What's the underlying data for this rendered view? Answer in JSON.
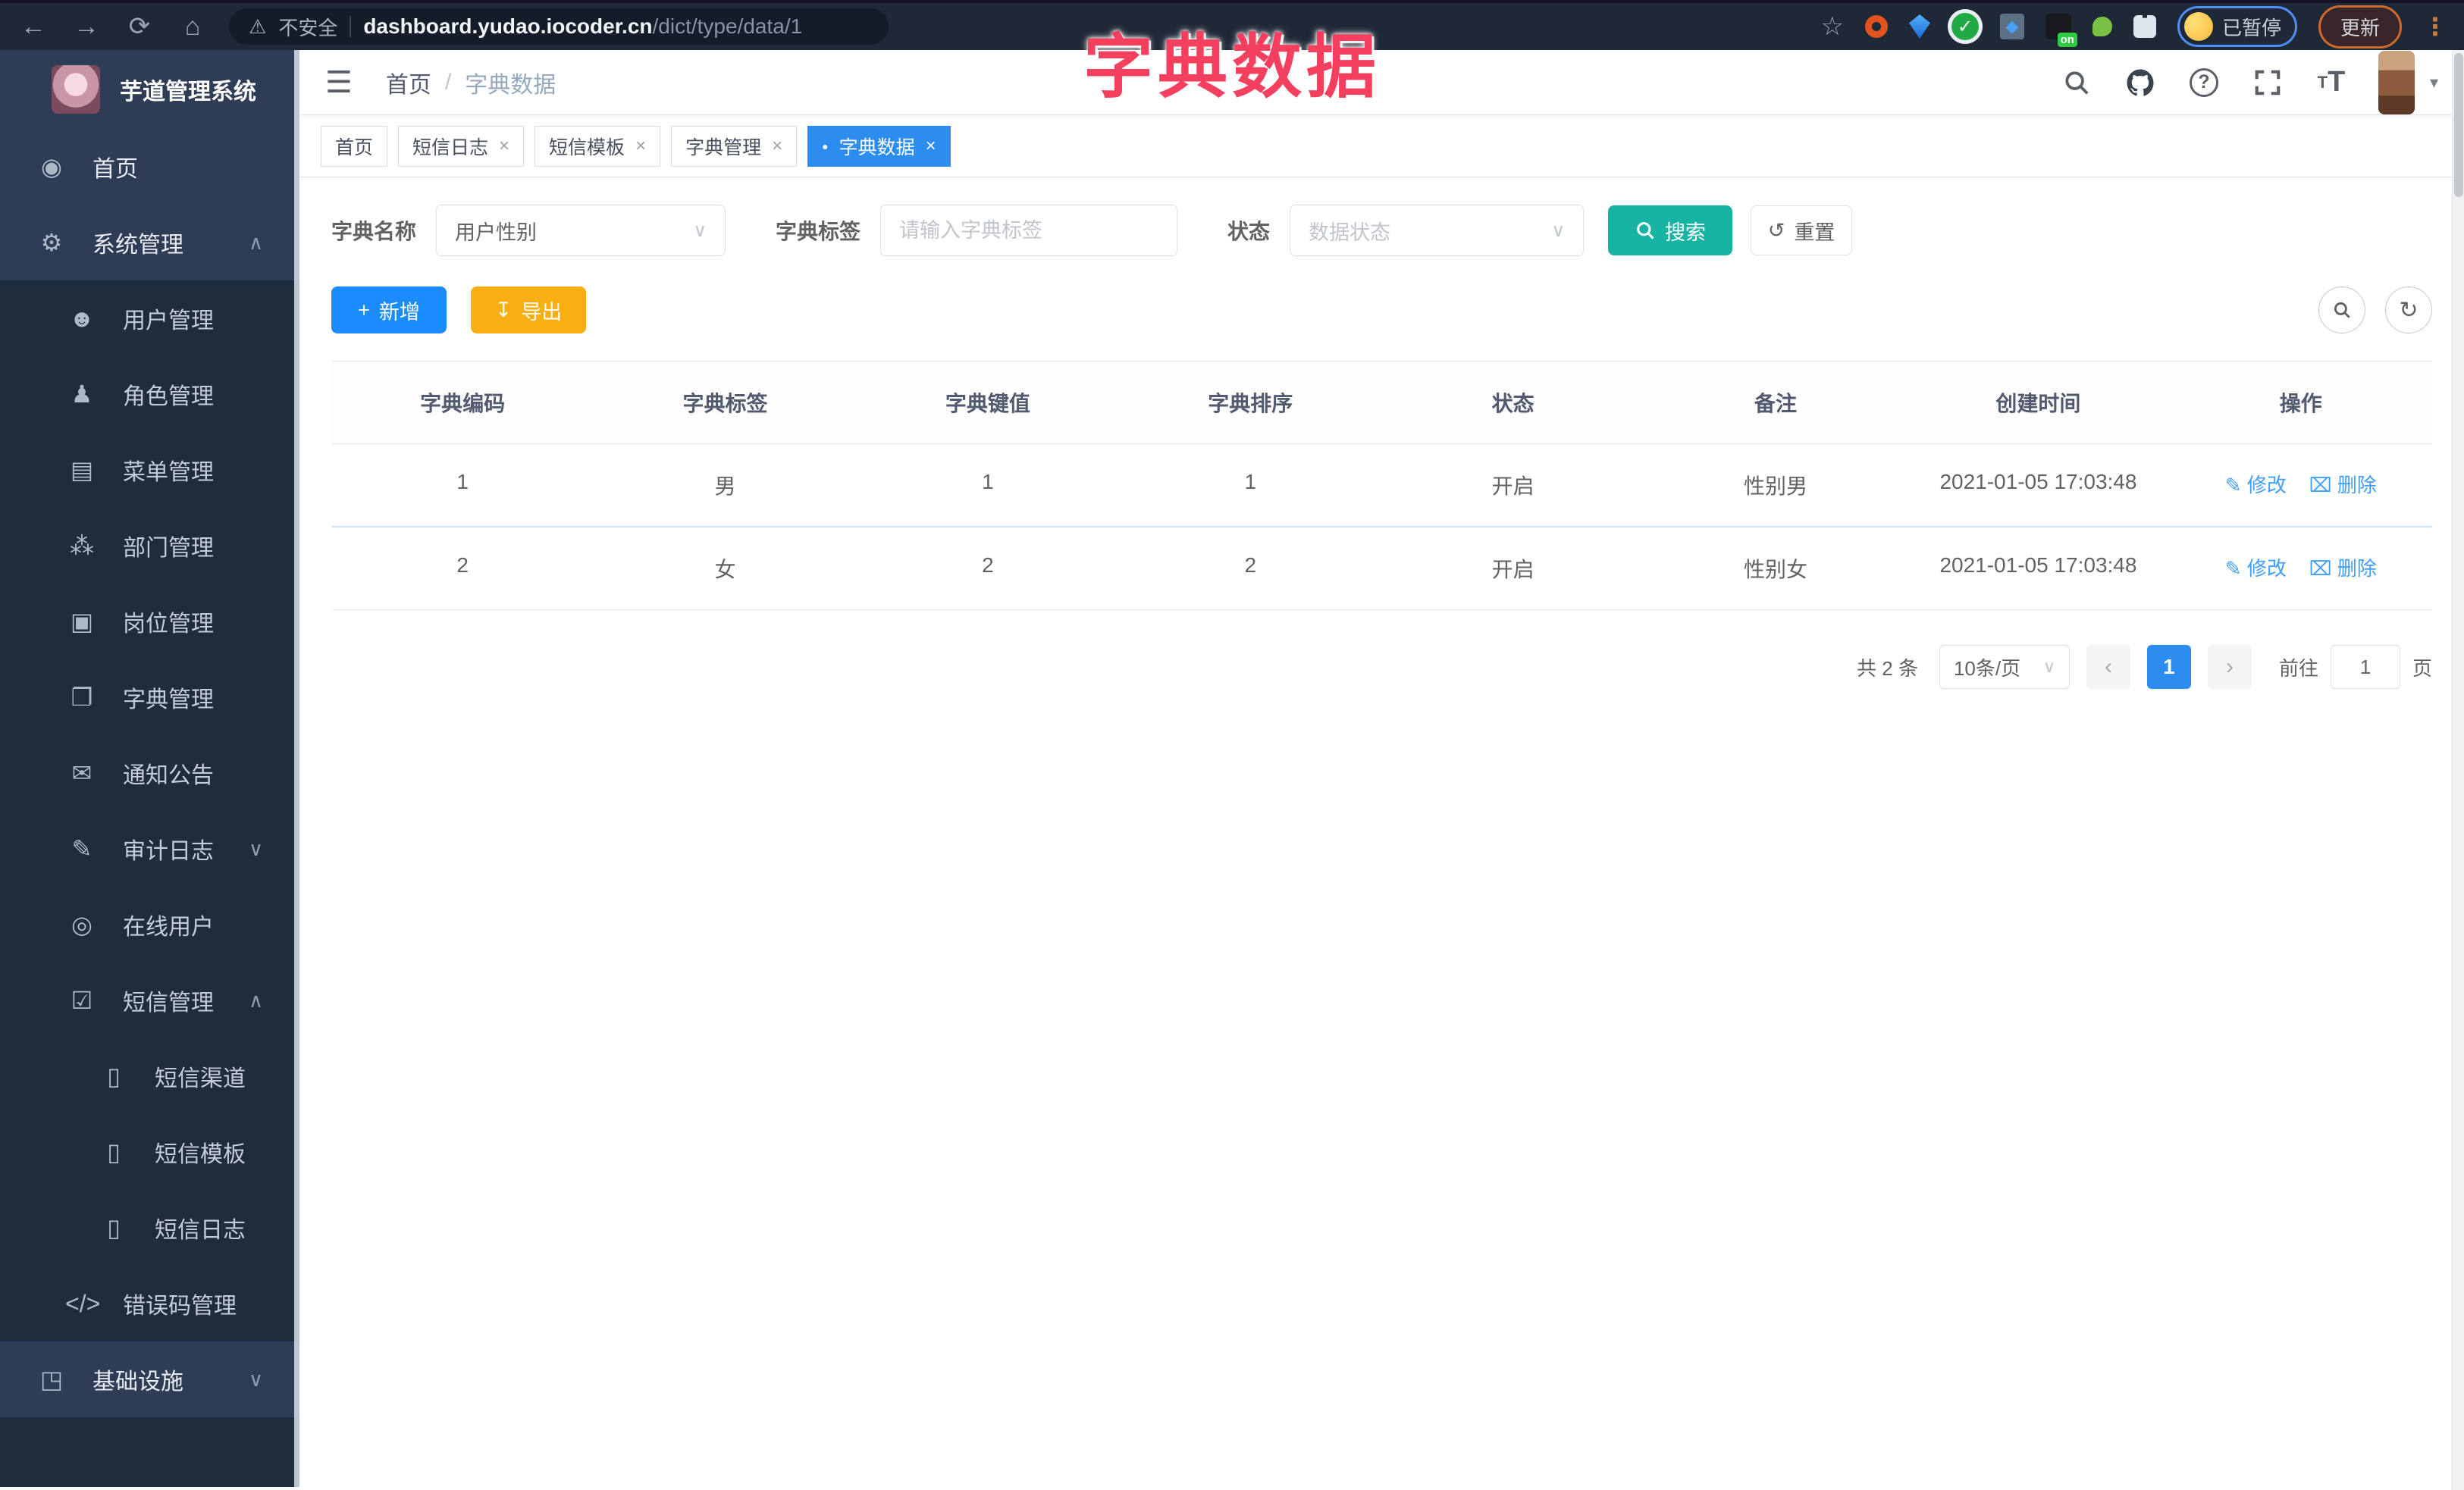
{
  "browser": {
    "security_label": "不安全",
    "url_domain": "dashboard.yudao.iocoder.cn",
    "url_path": "/dict/type/data/1",
    "extension_on_badge": "on",
    "paused_label": "已暂停",
    "update_label": "更新"
  },
  "overlay_title": "字典数据",
  "glyphs": {
    "back": "←",
    "forward": "→",
    "reload": "⟳",
    "home": "⌂",
    "warning": "⚠",
    "star": "☆",
    "kebab": "⋮",
    "hamburger": "☰",
    "caret_down": "▾",
    "check": "✓",
    "diamond": "◆",
    "select_caret": "∨",
    "collapse": "∧",
    "expand": "∨",
    "plus": "+",
    "download": "↧",
    "reset": "↺",
    "refresh": "↻",
    "edit": "✎",
    "delete": "⌧",
    "prev": "‹",
    "next": "›",
    "close": "×",
    "dot": "●",
    "help": "?",
    "font_small": "T",
    "font_big": "T"
  },
  "sidebar": {
    "logo_title": "芋道管理系统",
    "items": [
      {
        "label": "首页",
        "icon": "◉"
      },
      {
        "label": "系统管理",
        "icon": "⚙",
        "caret": "∧"
      },
      {
        "label": "用户管理",
        "icon": "☻"
      },
      {
        "label": "角色管理",
        "icon": "♟"
      },
      {
        "label": "菜单管理",
        "icon": "▤"
      },
      {
        "label": "部门管理",
        "icon": "⁂"
      },
      {
        "label": "岗位管理",
        "icon": "▣"
      },
      {
        "label": "字典管理",
        "icon": "❐"
      },
      {
        "label": "通知公告",
        "icon": "✉"
      },
      {
        "label": "审计日志",
        "icon": "✎",
        "caret": "∨"
      },
      {
        "label": "在线用户",
        "icon": "◎"
      },
      {
        "label": "短信管理",
        "icon": "☑",
        "caret": "∧"
      },
      {
        "label": "短信渠道",
        "icon": "▯"
      },
      {
        "label": "短信模板",
        "icon": "▯"
      },
      {
        "label": "短信日志",
        "icon": "▯"
      },
      {
        "label": "错误码管理",
        "icon": "</>"
      },
      {
        "label": "基础设施",
        "icon": "◳",
        "caret": "∨"
      }
    ]
  },
  "header": {
    "breadcrumb": {
      "home": "首页",
      "sep": "/",
      "current": "字典数据"
    }
  },
  "tabs": [
    {
      "label": "首页"
    },
    {
      "label": "短信日志"
    },
    {
      "label": "短信模板"
    },
    {
      "label": "字典管理"
    },
    {
      "label": "字典数据"
    }
  ],
  "filters": {
    "dict_name_label": "字典名称",
    "dict_name_value": "用户性别",
    "dict_label_label": "字典标签",
    "dict_label_placeholder": "请输入字典标签",
    "status_label": "状态",
    "status_placeholder": "数据状态",
    "search_label": "搜索",
    "reset_label": "重置"
  },
  "toolbar": {
    "add_label": "新增",
    "export_label": "导出"
  },
  "table": {
    "headers": [
      "字典编码",
      "字典标签",
      "字典键值",
      "字典排序",
      "状态",
      "备注",
      "创建时间",
      "操作"
    ],
    "actions": {
      "edit": "修改",
      "delete": "删除"
    },
    "rows": [
      {
        "code": "1",
        "label": "男",
        "value": "1",
        "sort": "1",
        "status": "开启",
        "remark": "性别男",
        "created": "2021-01-05 17:03:48"
      },
      {
        "code": "2",
        "label": "女",
        "value": "2",
        "sort": "2",
        "status": "开启",
        "remark": "性别女",
        "created": "2021-01-05 17:03:48"
      }
    ]
  },
  "pagination": {
    "total_text": "共 2 条",
    "page_size": "10条/页",
    "current_page": "1",
    "goto_label": "前往",
    "goto_value": "1",
    "page_unit": "页"
  },
  "colors": {
    "accent_blue": "#2d8cf0",
    "link_blue": "#409eff",
    "teal": "#17b3a3",
    "orange": "#f9ae13",
    "pink": "#f4405e"
  }
}
